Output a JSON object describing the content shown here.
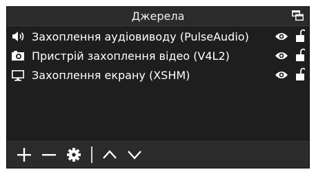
{
  "panel": {
    "title": "Джерела"
  },
  "sources": [
    {
      "name": "Захоплення аудіовиводу (PulseAudio)",
      "icon": "speaker-icon",
      "visible": true,
      "locked": false
    },
    {
      "name": "Пристрій захоплення відео (V4L2)",
      "icon": "camera-icon",
      "visible": true,
      "locked": false
    },
    {
      "name": "Захоплення екрану (XSHM)",
      "icon": "monitor-icon",
      "visible": true,
      "locked": false
    }
  ],
  "toolbar": {
    "buttons": [
      "add-icon",
      "remove-icon",
      "gear-icon",
      "chevron-up-icon",
      "chevron-down-icon"
    ]
  },
  "colors": {
    "panel_bg": "#1e1e1e",
    "bar_bg": "#2b2b2b",
    "text": "#ffffff"
  }
}
